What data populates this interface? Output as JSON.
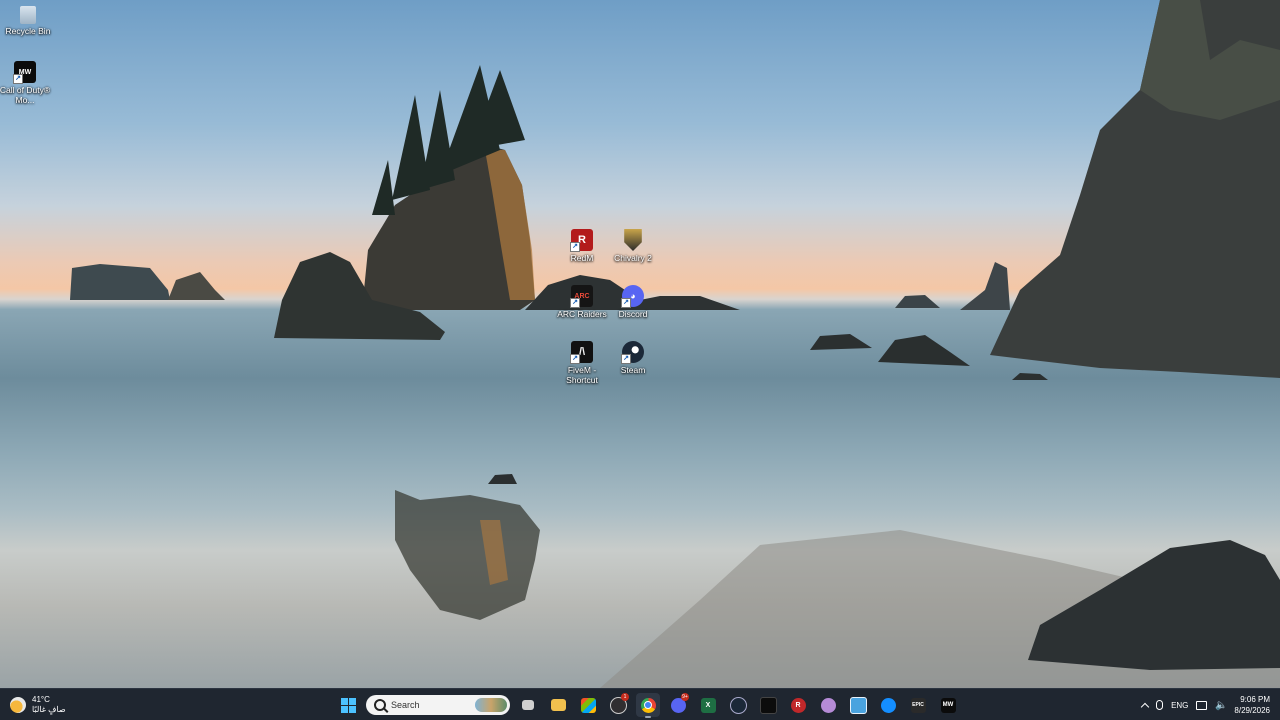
{
  "desktop": {
    "icons": [
      {
        "label": "Recycle Bin",
        "icon": "recycle-bin-icon"
      },
      {
        "label": "Call of Duty® Mo...",
        "icon": "call-of-duty-icon"
      },
      {
        "label": "RedM",
        "icon": "redm-icon"
      },
      {
        "label": "Chivalry 2",
        "icon": "chivalry-2-icon"
      },
      {
        "label": "ARC Raiders",
        "icon": "arc-raiders-icon"
      },
      {
        "label": "Discord",
        "icon": "discord-icon"
      },
      {
        "label": "FiveM - Shortcut",
        "icon": "fivem-icon"
      },
      {
        "label": "Steam",
        "icon": "steam-icon"
      }
    ]
  },
  "taskbar": {
    "weather": {
      "temp": "41°C",
      "condition": "صافٍ غالبًا"
    },
    "search": {
      "placeholder": "Search"
    },
    "apps": [
      {
        "name": "task-view",
        "badge": ""
      },
      {
        "name": "file-explorer",
        "badge": ""
      },
      {
        "name": "microsoft-store",
        "badge": ""
      },
      {
        "name": "obs-studio",
        "badge": "1"
      },
      {
        "name": "google-chrome",
        "badge": ""
      },
      {
        "name": "discord",
        "badge": "9+"
      },
      {
        "name": "excel",
        "badge": ""
      },
      {
        "name": "steam",
        "badge": ""
      },
      {
        "name": "terminal",
        "badge": ""
      },
      {
        "name": "redm",
        "badge": ""
      },
      {
        "name": "unknown-app",
        "badge": ""
      },
      {
        "name": "notepad",
        "badge": ""
      },
      {
        "name": "battle-net",
        "badge": ""
      },
      {
        "name": "epic-games",
        "badge": ""
      },
      {
        "name": "call-of-duty",
        "badge": ""
      }
    ],
    "tray": {
      "language": "ENG"
    },
    "clock": {
      "time": "9:06 PM",
      "date": "8/29/2026"
    }
  },
  "colors": {
    "taskbar_bg": "#1f2630",
    "accent": "#4cc2ff",
    "badge": "#c42b1c"
  }
}
